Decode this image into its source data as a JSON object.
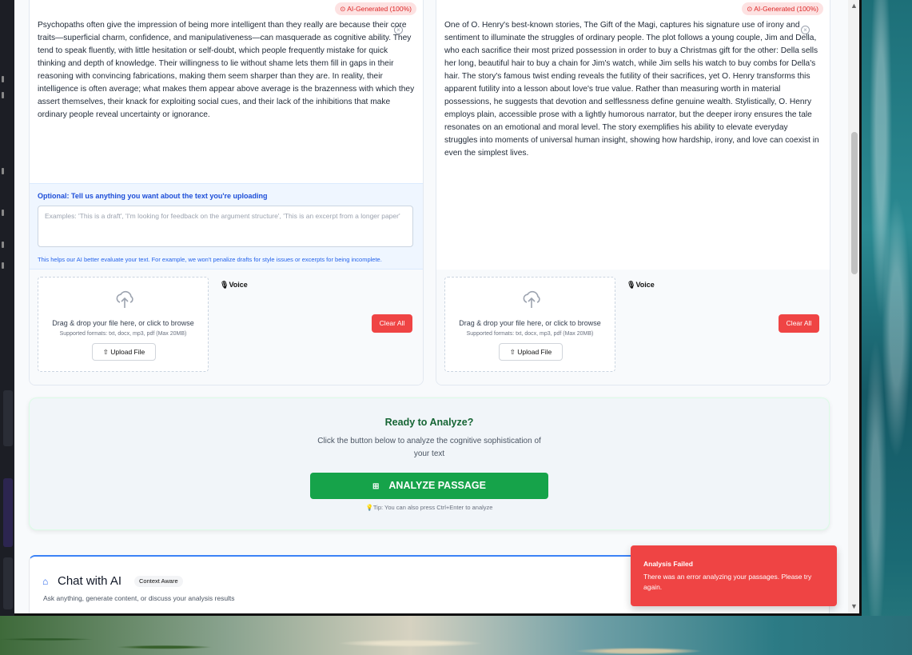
{
  "left_panel": {
    "badge": "AI-Generated (100%)",
    "passage": "Psychopaths often give the impression of being more intelligent than they really are because their core traits—superficial charm, confidence, and manipulativeness—can masquerade as cognitive ability. They tend to speak fluently, with little hesitation or self-doubt, which people frequently mistake for quick thinking and depth of knowledge. Their willingness to lie without shame lets them fill in gaps in their reasoning with convincing fabrications, making them seem sharper than they are. In reality, their intelligence is often average; what makes them appear above average is the brazenness with which they assert themselves, their knack for exploiting social cues, and their lack of the inhibitions that make ordinary people reveal uncertainty or ignorance.",
    "note_title": "Optional: Tell us anything you want about the text you're uploading",
    "note_placeholder": "Examples: 'This is a draft', 'I'm looking for feedback on the argument structure', 'This is an excerpt from a longer paper'",
    "note_help": "This helps our AI better evaluate your text. For example, we won't penalize drafts for style issues or excerpts for being incomplete.",
    "upload_text": "Drag & drop your file here, or click to browse",
    "upload_formats": "Supported formats: txt, docx, mp3, pdf (Max 20MB)",
    "upload_button": "Upload File",
    "voice_label": "Voice",
    "clear_label": "Clear All"
  },
  "right_panel": {
    "badge": "AI-Generated (100%)",
    "passage": "One of O. Henry's best-known stories, The Gift of the Magi, captures his signature use of irony and sentiment to illuminate the struggles of ordinary people. The plot follows a young couple, Jim and Della, who each sacrifice their most prized possession in order to buy a Christmas gift for the other: Della sells her long, beautiful hair to buy a chain for Jim's watch, while Jim sells his watch to buy combs for Della's hair. The story's famous twist ending reveals the futility of their sacrifices, yet O. Henry transforms this apparent futility into a lesson about love's true value. Rather than measuring worth in material possessions, he suggests that devotion and selflessness define genuine wealth. Stylistically, O. Henry employs plain, accessible prose with a lightly humorous narrator, but the deeper irony ensures the tale resonates on an emotional and moral level. The story exemplifies his ability to elevate everyday struggles into moments of universal human insight, showing how hardship, irony, and love can coexist in even the simplest lives.",
    "upload_text": "Drag & drop your file here, or click to browse",
    "upload_formats": "Supported formats: txt, docx, mp3, pdf (Max 20MB)",
    "upload_button": "Upload File",
    "voice_label": "Voice",
    "clear_label": "Clear All"
  },
  "analyze": {
    "title": "Ready to Analyze?",
    "description": "Click the button below to analyze the cognitive sophistication of your text",
    "button_label": "ANALYZE PASSAGE",
    "tip": "Tip: You can also press Ctrl+Enter to analyze"
  },
  "chat": {
    "title": "Chat with AI",
    "badge": "Context Aware",
    "subtitle": "Ask anything, generate content, or discuss your analysis results"
  },
  "toast": {
    "title": "Analysis Failed",
    "message": "There was an error analyzing your passages. Please try again."
  },
  "colors": {
    "accent_green": "#16a34a",
    "danger_red": "#ef4444",
    "link_blue": "#2563eb"
  }
}
